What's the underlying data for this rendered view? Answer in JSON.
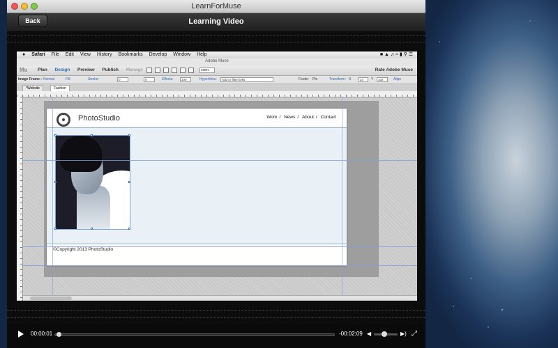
{
  "window": {
    "title": "LearnForMuse"
  },
  "header": {
    "back_label": "Back",
    "title": "Learning Video"
  },
  "mac_menu": {
    "items": [
      "Safari",
      "File",
      "Edit",
      "View",
      "History",
      "Bookmarks",
      "Develop",
      "Window",
      "Help"
    ]
  },
  "muse": {
    "window_title": "Adobe Muse",
    "logo": "Mu",
    "modes": [
      "Plan",
      "Design",
      "Preview",
      "Publish",
      "Manage"
    ],
    "active_mode": "Design",
    "rate_label": "Rate Adobe Muse",
    "zoom": "100%",
    "controls": {
      "image_frame": "Image Frame :",
      "normal": "Normal",
      "fill": "Fill:",
      "stroke": "Stroke:",
      "stroke_val": "0",
      "pad_val": "0",
      "effects": "Effects:",
      "opacity": "100",
      "hyperlinks": "Hyperlinks:",
      "links_placeholder": "Add or filter links",
      "footer": "Footer",
      "pin": "Pin",
      "transform": "Transform:",
      "x_label": "X",
      "x_val": "24",
      "y_label": "Y",
      "y_val": "102",
      "align": "Align"
    },
    "tabs": [
      "*Website",
      "Fashion"
    ]
  },
  "site": {
    "brand": "PhotoStudio",
    "nav": [
      "Work",
      "News",
      "About",
      "Contact"
    ],
    "nav_sep": "/",
    "footer": "©Copyright 2013 PhotoStudio"
  },
  "player": {
    "elapsed": "00:00:01",
    "remaining": "-00:02:09",
    "progress": 0.008,
    "volume": 0.45
  }
}
